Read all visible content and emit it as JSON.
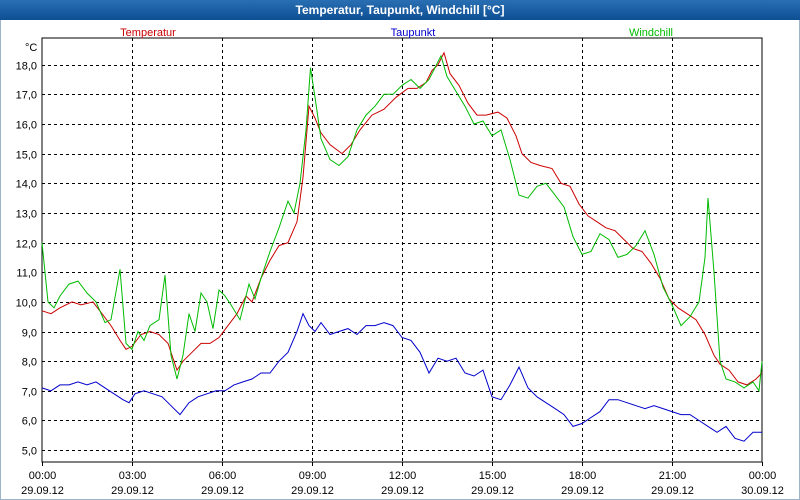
{
  "window": {
    "title": "Temperatur, Taupunkt, Windchill [°C]"
  },
  "chart_data": {
    "type": "line",
    "title": "Temperatur, Taupunkt, Windchill [°C]",
    "ylabel": "°C",
    "ylim": [
      4.6,
      18.9
    ],
    "xlim": [
      "2012-09-29T00:00",
      "2012-09-30T00:00"
    ],
    "yticks": [
      "5,0",
      "6,0",
      "7,0",
      "8,0",
      "9,0",
      "10,0",
      "11,0",
      "12,0",
      "13,0",
      "14,0",
      "15,0",
      "16,0",
      "17,0",
      "18,0"
    ],
    "ytick_values": [
      5,
      6,
      7,
      8,
      9,
      10,
      11,
      12,
      13,
      14,
      15,
      16,
      17,
      18
    ],
    "xticks": [
      {
        "time": "00:00",
        "date": "29.09.12",
        "hour": 0
      },
      {
        "time": "03:00",
        "date": "29.09.12",
        "hour": 3
      },
      {
        "time": "06:00",
        "date": "29.09.12",
        "hour": 6
      },
      {
        "time": "09:00",
        "date": "29.09.12",
        "hour": 9
      },
      {
        "time": "12:00",
        "date": "29.09.12",
        "hour": 12
      },
      {
        "time": "15:00",
        "date": "29.09.12",
        "hour": 15
      },
      {
        "time": "18:00",
        "date": "29.09.12",
        "hour": 18
      },
      {
        "time": "21:00",
        "date": "29.09.12",
        "hour": 21
      },
      {
        "time": "00:00",
        "date": "30.09.12",
        "hour": 24
      }
    ],
    "grid": true,
    "legend_placement": "top",
    "series": [
      {
        "name": "Temperatur",
        "color": "#cc0000",
        "points": [
          [
            0,
            9.7
          ],
          [
            0.3,
            9.6
          ],
          [
            0.6,
            9.8
          ],
          [
            1.0,
            10.0
          ],
          [
            1.3,
            9.9
          ],
          [
            1.7,
            10.0
          ],
          [
            2.0,
            9.6
          ],
          [
            2.3,
            9.2
          ],
          [
            2.6,
            8.7
          ],
          [
            2.8,
            8.4
          ],
          [
            3.0,
            8.5
          ],
          [
            3.3,
            8.9
          ],
          [
            3.6,
            9.0
          ],
          [
            3.9,
            8.9
          ],
          [
            4.2,
            8.6
          ],
          [
            4.5,
            7.7
          ],
          [
            4.7,
            8.0
          ],
          [
            5.0,
            8.3
          ],
          [
            5.3,
            8.6
          ],
          [
            5.6,
            8.6
          ],
          [
            5.9,
            8.8
          ],
          [
            6.2,
            9.2
          ],
          [
            6.5,
            9.6
          ],
          [
            6.8,
            10.2
          ],
          [
            7.0,
            10.0
          ],
          [
            7.3,
            10.8
          ],
          [
            7.6,
            11.4
          ],
          [
            7.9,
            11.9
          ],
          [
            8.2,
            12.0
          ],
          [
            8.5,
            12.7
          ],
          [
            8.7,
            14.2
          ],
          [
            8.9,
            16.6
          ],
          [
            9.1,
            16.2
          ],
          [
            9.3,
            15.7
          ],
          [
            9.6,
            15.3
          ],
          [
            10.0,
            15.0
          ],
          [
            10.3,
            15.3
          ],
          [
            10.6,
            15.8
          ],
          [
            11.0,
            16.3
          ],
          [
            11.4,
            16.5
          ],
          [
            11.8,
            16.9
          ],
          [
            12.2,
            17.2
          ],
          [
            12.5,
            17.2
          ],
          [
            12.8,
            17.4
          ],
          [
            13.0,
            17.8
          ],
          [
            13.2,
            18.0
          ],
          [
            13.4,
            18.4
          ],
          [
            13.6,
            17.7
          ],
          [
            13.9,
            17.3
          ],
          [
            14.2,
            16.7
          ],
          [
            14.5,
            16.3
          ],
          [
            14.8,
            16.3
          ],
          [
            15.2,
            16.4
          ],
          [
            15.5,
            16.2
          ],
          [
            15.8,
            15.6
          ],
          [
            16.0,
            15.0
          ],
          [
            16.3,
            14.7
          ],
          [
            16.6,
            14.6
          ],
          [
            17.0,
            14.5
          ],
          [
            17.3,
            14.0
          ],
          [
            17.6,
            13.9
          ],
          [
            17.9,
            13.3
          ],
          [
            18.2,
            12.9
          ],
          [
            18.5,
            12.7
          ],
          [
            18.8,
            12.5
          ],
          [
            19.1,
            12.4
          ],
          [
            19.4,
            12.1
          ],
          [
            19.7,
            11.8
          ],
          [
            20.0,
            11.7
          ],
          [
            20.3,
            11.3
          ],
          [
            20.6,
            10.8
          ],
          [
            20.9,
            10.1
          ],
          [
            21.2,
            9.8
          ],
          [
            21.5,
            9.6
          ],
          [
            21.8,
            9.4
          ],
          [
            22.1,
            8.9
          ],
          [
            22.4,
            8.2
          ],
          [
            22.6,
            7.9
          ],
          [
            22.9,
            7.7
          ],
          [
            23.2,
            7.3
          ],
          [
            23.5,
            7.2
          ],
          [
            23.8,
            7.4
          ],
          [
            24.0,
            7.6
          ]
        ]
      },
      {
        "name": "Taupunkt",
        "color": "#0000cc",
        "points": [
          [
            0,
            7.1
          ],
          [
            0.3,
            7.0
          ],
          [
            0.6,
            7.2
          ],
          [
            0.9,
            7.2
          ],
          [
            1.2,
            7.3
          ],
          [
            1.5,
            7.2
          ],
          [
            1.8,
            7.3
          ],
          [
            2.1,
            7.1
          ],
          [
            2.4,
            6.9
          ],
          [
            2.7,
            6.7
          ],
          [
            2.9,
            6.6
          ],
          [
            3.1,
            6.9
          ],
          [
            3.4,
            7.0
          ],
          [
            3.7,
            6.9
          ],
          [
            4.0,
            6.8
          ],
          [
            4.3,
            6.5
          ],
          [
            4.6,
            6.2
          ],
          [
            4.9,
            6.6
          ],
          [
            5.2,
            6.8
          ],
          [
            5.5,
            6.9
          ],
          [
            5.8,
            7.0
          ],
          [
            6.1,
            7.0
          ],
          [
            6.4,
            7.2
          ],
          [
            6.7,
            7.3
          ],
          [
            7.0,
            7.4
          ],
          [
            7.3,
            7.6
          ],
          [
            7.6,
            7.6
          ],
          [
            7.9,
            8.0
          ],
          [
            8.2,
            8.3
          ],
          [
            8.5,
            9.0
          ],
          [
            8.7,
            9.6
          ],
          [
            8.9,
            9.2
          ],
          [
            9.1,
            9.0
          ],
          [
            9.3,
            9.3
          ],
          [
            9.6,
            8.9
          ],
          [
            9.9,
            9.0
          ],
          [
            10.2,
            9.1
          ],
          [
            10.5,
            8.9
          ],
          [
            10.8,
            9.2
          ],
          [
            11.1,
            9.2
          ],
          [
            11.4,
            9.3
          ],
          [
            11.7,
            9.2
          ],
          [
            12.0,
            8.8
          ],
          [
            12.3,
            8.7
          ],
          [
            12.6,
            8.3
          ],
          [
            12.9,
            7.6
          ],
          [
            13.2,
            8.1
          ],
          [
            13.5,
            8.0
          ],
          [
            13.8,
            8.1
          ],
          [
            14.1,
            7.6
          ],
          [
            14.4,
            7.5
          ],
          [
            14.7,
            7.7
          ],
          [
            15.0,
            6.8
          ],
          [
            15.3,
            6.7
          ],
          [
            15.6,
            7.2
          ],
          [
            15.9,
            7.8
          ],
          [
            16.2,
            7.1
          ],
          [
            16.5,
            6.8
          ],
          [
            16.8,
            6.6
          ],
          [
            17.1,
            6.4
          ],
          [
            17.4,
            6.2
          ],
          [
            17.7,
            5.8
          ],
          [
            18.0,
            5.9
          ],
          [
            18.3,
            6.1
          ],
          [
            18.6,
            6.3
          ],
          [
            18.9,
            6.7
          ],
          [
            19.2,
            6.7
          ],
          [
            19.5,
            6.6
          ],
          [
            19.8,
            6.5
          ],
          [
            20.1,
            6.4
          ],
          [
            20.4,
            6.5
          ],
          [
            20.7,
            6.4
          ],
          [
            21.0,
            6.3
          ],
          [
            21.3,
            6.2
          ],
          [
            21.6,
            6.2
          ],
          [
            21.9,
            6.0
          ],
          [
            22.2,
            5.8
          ],
          [
            22.5,
            5.6
          ],
          [
            22.8,
            5.8
          ],
          [
            23.1,
            5.4
          ],
          [
            23.4,
            5.3
          ],
          [
            23.7,
            5.6
          ],
          [
            24.0,
            5.6
          ]
        ]
      },
      {
        "name": "Windchill",
        "color": "#00bb00",
        "points": [
          [
            0,
            12.0
          ],
          [
            0.2,
            10.0
          ],
          [
            0.4,
            9.8
          ],
          [
            0.6,
            10.2
          ],
          [
            0.9,
            10.6
          ],
          [
            1.2,
            10.7
          ],
          [
            1.5,
            10.3
          ],
          [
            1.8,
            10.0
          ],
          [
            2.1,
            9.3
          ],
          [
            2.3,
            9.4
          ],
          [
            2.6,
            11.1
          ],
          [
            2.8,
            8.6
          ],
          [
            3.0,
            8.4
          ],
          [
            3.2,
            9.0
          ],
          [
            3.4,
            8.7
          ],
          [
            3.6,
            9.2
          ],
          [
            3.9,
            9.4
          ],
          [
            4.1,
            10.9
          ],
          [
            4.3,
            8.2
          ],
          [
            4.5,
            7.4
          ],
          [
            4.7,
            8.2
          ],
          [
            4.9,
            9.6
          ],
          [
            5.1,
            9.0
          ],
          [
            5.3,
            10.3
          ],
          [
            5.5,
            10.0
          ],
          [
            5.7,
            9.1
          ],
          [
            5.9,
            10.4
          ],
          [
            6.1,
            10.2
          ],
          [
            6.3,
            9.9
          ],
          [
            6.6,
            9.4
          ],
          [
            6.9,
            10.6
          ],
          [
            7.1,
            10.1
          ],
          [
            7.3,
            10.8
          ],
          [
            7.6,
            11.7
          ],
          [
            7.9,
            12.5
          ],
          [
            8.2,
            13.4
          ],
          [
            8.4,
            13.0
          ],
          [
            8.6,
            14.0
          ],
          [
            8.8,
            15.8
          ],
          [
            8.95,
            17.9
          ],
          [
            9.1,
            16.9
          ],
          [
            9.3,
            15.5
          ],
          [
            9.6,
            14.8
          ],
          [
            9.9,
            14.6
          ],
          [
            10.2,
            14.9
          ],
          [
            10.5,
            15.8
          ],
          [
            10.8,
            16.3
          ],
          [
            11.1,
            16.6
          ],
          [
            11.4,
            17.0
          ],
          [
            11.7,
            17.0
          ],
          [
            12.0,
            17.3
          ],
          [
            12.3,
            17.5
          ],
          [
            12.6,
            17.2
          ],
          [
            12.9,
            17.5
          ],
          [
            13.1,
            17.9
          ],
          [
            13.3,
            18.3
          ],
          [
            13.5,
            17.6
          ],
          [
            13.8,
            17.1
          ],
          [
            14.1,
            16.6
          ],
          [
            14.4,
            16.0
          ],
          [
            14.7,
            16.1
          ],
          [
            15.0,
            15.6
          ],
          [
            15.3,
            15.8
          ],
          [
            15.6,
            14.8
          ],
          [
            15.9,
            13.6
          ],
          [
            16.2,
            13.5
          ],
          [
            16.5,
            13.9
          ],
          [
            16.8,
            14.0
          ],
          [
            17.1,
            13.6
          ],
          [
            17.4,
            13.2
          ],
          [
            17.7,
            12.2
          ],
          [
            18.0,
            11.6
          ],
          [
            18.3,
            11.7
          ],
          [
            18.6,
            12.3
          ],
          [
            18.9,
            12.1
          ],
          [
            19.2,
            11.5
          ],
          [
            19.5,
            11.6
          ],
          [
            19.8,
            11.9
          ],
          [
            20.1,
            12.4
          ],
          [
            20.4,
            11.6
          ],
          [
            20.7,
            10.5
          ],
          [
            21.0,
            9.9
          ],
          [
            21.3,
            9.2
          ],
          [
            21.6,
            9.5
          ],
          [
            21.9,
            10.0
          ],
          [
            22.1,
            11.5
          ],
          [
            22.2,
            13.5
          ],
          [
            22.4,
            11.0
          ],
          [
            22.6,
            8.0
          ],
          [
            22.8,
            7.4
          ],
          [
            23.1,
            7.3
          ],
          [
            23.4,
            7.1
          ],
          [
            23.7,
            7.3
          ],
          [
            23.9,
            7.0
          ],
          [
            24.0,
            8.0
          ]
        ]
      }
    ]
  }
}
